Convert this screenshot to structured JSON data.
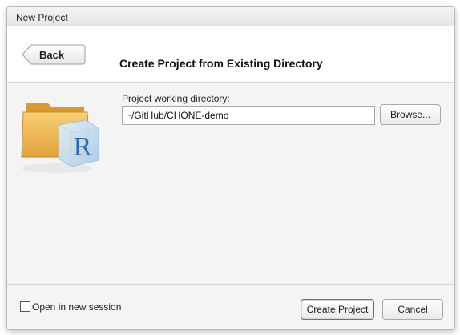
{
  "window": {
    "title": "New Project"
  },
  "header": {
    "back_label": "Back",
    "title": "Create Project from Existing Directory"
  },
  "form": {
    "field_label": "Project working directory:",
    "directory_value": "~/GitHub/CHONE-demo",
    "browse_label": "Browse..."
  },
  "footer": {
    "open_new_session_label": "Open in new session",
    "open_new_session_checked": false,
    "create_label": "Create Project",
    "cancel_label": "Cancel"
  },
  "icons": {
    "project_icon": "folder-r-icon",
    "back_icon": "back-arrow-icon"
  },
  "colors": {
    "folder": "#f2b84b",
    "r_cube": "#bcd7ef",
    "r_letter": "#2a6db3"
  }
}
